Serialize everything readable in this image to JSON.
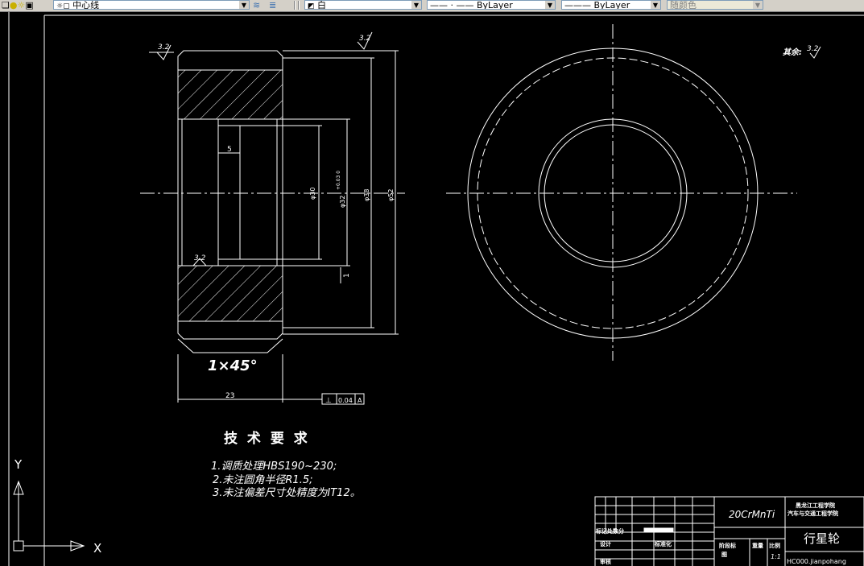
{
  "toolbar": {
    "layer_name": "中心线",
    "color_value": "白",
    "linetype_value": "ByLayer",
    "lineweight_value": "ByLayer",
    "plotstyle_value": "随颜色"
  },
  "drawing": {
    "roughness_left_top": "3.2",
    "roughness_right_top": "3.2",
    "roughness_inner": "3.2",
    "other_roughness_label": "其余:",
    "other_roughness_value": "3.2",
    "dim_5": "5",
    "dim_d30": "φ30",
    "dim_d32": "φ32",
    "dim_d32_tol": "+0.03 0",
    "dim_d38": "φ38",
    "dim_d52": "φ52",
    "dim_23": "23",
    "dim_1": "1",
    "chamfer": "1×45°",
    "geo_tol_symbol": "⊥",
    "geo_tol_value": "0.04",
    "geo_tol_datum": "A"
  },
  "requirements": {
    "title": "技 术 要 求",
    "items": [
      "1.调质处理HBS190~230;",
      "2.未注圆角半径R1.5;",
      "3.未注偏差尺寸处精度为IT12。"
    ]
  },
  "titleblock": {
    "material": "20CrMnTi",
    "school_line1": "黑龙江工程学院",
    "school_line2": "汽车与交通工程学院",
    "part_name": "行星轮",
    "design_label": "设计",
    "std_label": "标准化",
    "mark_label": "标记处数分",
    "check_label": "审核",
    "stage_label": "阶段标",
    "weight_label": "重量",
    "scale_label": "比例",
    "scale_value": "1:1",
    "draft_label": "图",
    "file_id": "HC000.jianpohang"
  },
  "ucs": {
    "x_label": "X",
    "y_label": "Y"
  }
}
